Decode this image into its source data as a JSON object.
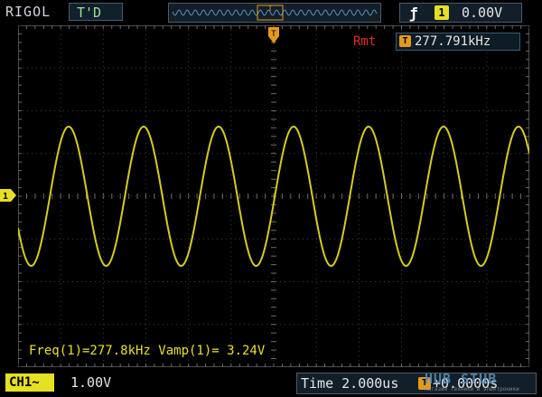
{
  "header": {
    "brand": "RIGOL",
    "run_state": "T'D"
  },
  "trigger": {
    "edge_icon": "rising-edge-icon",
    "source": "1",
    "level": "0.00V"
  },
  "counter": {
    "mode_label": "Rmt",
    "icon_letter": "T",
    "frequency": "277.791kHz"
  },
  "channel": {
    "marker": "1",
    "label": "CH1",
    "coupling_icon": "~",
    "scale": "1.00V",
    "color": "#e6e023"
  },
  "measurements": {
    "text": "Freq(1)=277.8kHz  Vamp(1)= 3.24V"
  },
  "timebase": {
    "label": "Time 2.000us",
    "icon_letter": "T",
    "offset": "+0.0000s"
  },
  "watermark": {
    "text": "HUB STUB",
    "sub": "Магазин техники и электроники"
  }
}
